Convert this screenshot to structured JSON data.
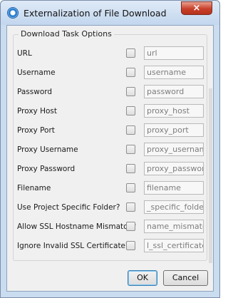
{
  "window": {
    "title": "Externalization of File Download",
    "close_glyph": "×"
  },
  "group": {
    "legend": "Download Task Options"
  },
  "rows": [
    {
      "label": "URL",
      "value": "url"
    },
    {
      "label": "Username",
      "value": "username"
    },
    {
      "label": "Password",
      "value": "password"
    },
    {
      "label": "Proxy Host",
      "value": "proxy_host"
    },
    {
      "label": "Proxy Port",
      "value": "proxy_port"
    },
    {
      "label": "Proxy Username",
      "value": "proxy_username"
    },
    {
      "label": "Proxy Password",
      "value": "proxy_password"
    },
    {
      "label": "Filename",
      "value": "filename"
    },
    {
      "label": "Use Project Specific Folder?",
      "value": "_specific_folder?"
    },
    {
      "label": "Allow SSL Hostname Mismatch?",
      "value": "name_mismatch?"
    },
    {
      "label": "Ignore Invalid SSL Certificate?",
      "value": "l_ssl_certificate?"
    }
  ],
  "buttons": {
    "ok": "OK",
    "cancel": "Cancel"
  },
  "icons": {
    "app": "app-circle-icon",
    "close": "close-icon"
  }
}
